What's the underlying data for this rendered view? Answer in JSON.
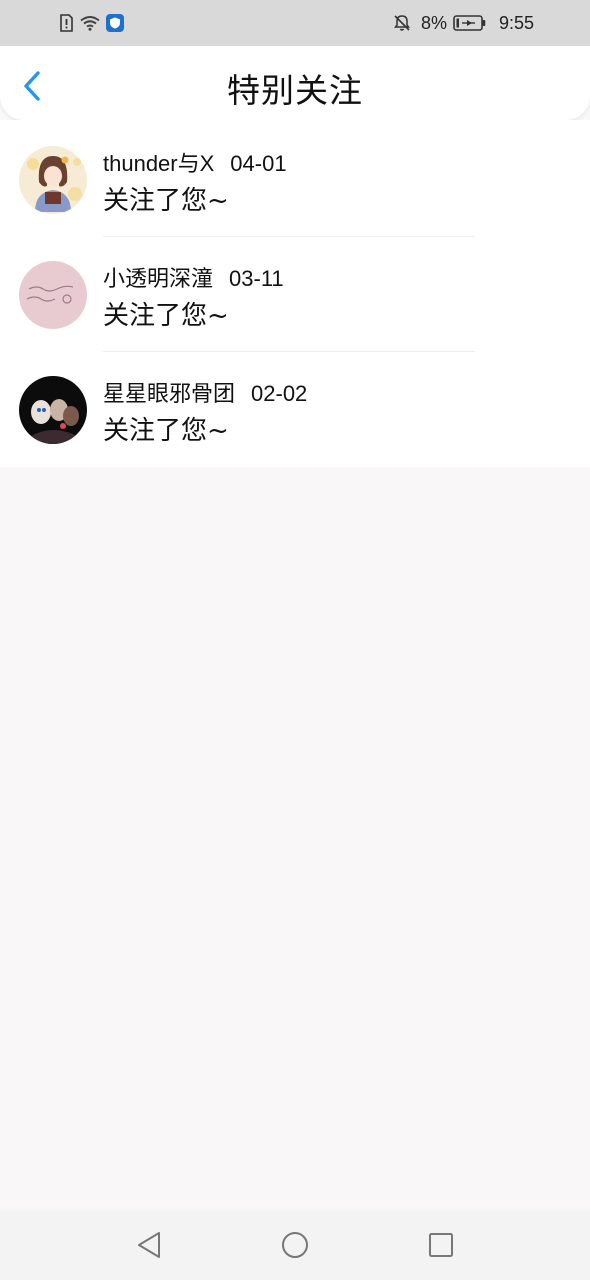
{
  "status_bar": {
    "battery_percent": "8%",
    "time": "9:55",
    "icons": [
      "sim-alert-icon",
      "wifi-icon",
      "shield-app-icon",
      "bell-off-icon",
      "battery-icon"
    ],
    "shield_color": "#1e6fd0"
  },
  "header": {
    "title": "特别关注",
    "back_icon": "chevron-left-icon",
    "accent_color": "#2196f3"
  },
  "notifications": [
    {
      "name": "thunder与X",
      "date": "04-01",
      "message": "关注了您~"
    },
    {
      "name": "小透明深潼",
      "date": "03-11",
      "message": "关注了您~"
    },
    {
      "name": "星星眼邪骨团",
      "date": "02-02",
      "message": "关注了您~"
    }
  ],
  "nav": {
    "back": "triangle-back-icon",
    "home": "circle-home-icon",
    "recents": "square-recents-icon"
  }
}
